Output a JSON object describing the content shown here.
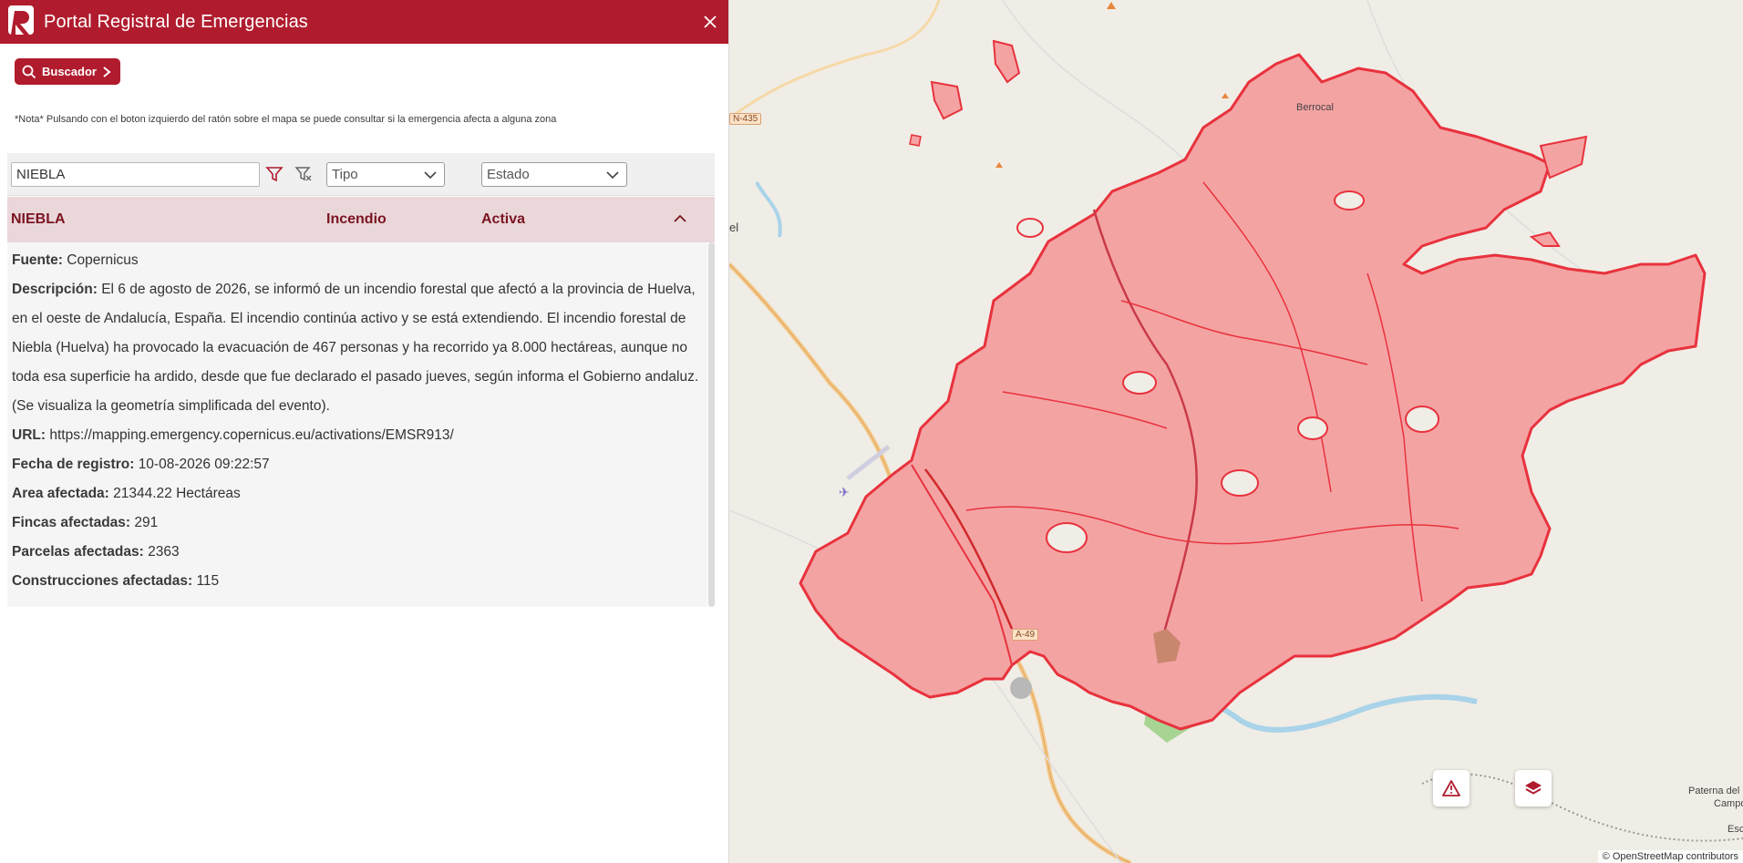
{
  "app": {
    "title": "Portal Registral de Emergencias",
    "logo_letter": "R"
  },
  "toolbar": {
    "buscador_label": "Buscador"
  },
  "note": "*Nota* Pulsando con el boton izquierdo del ratón sobre el mapa se puede consultar si la emergencia afecta a alguna zona",
  "filters": {
    "search_value": "NIEBLA",
    "tipo_label": "Tipo",
    "estado_label": "Estado"
  },
  "result": {
    "name": "NIEBLA",
    "tipo": "Incendio",
    "estado": "Activa"
  },
  "details": {
    "fuente_label": "Fuente:",
    "fuente_value": "Copernicus",
    "descripcion_label": "Descripción:",
    "descripcion_value": "El 6 de agosto de 2026, se informó de un incendio forestal que afectó a la provincia de Huelva, en el oeste de Andalucía, España. El incendio continúa activo y se está extendiendo. El incendio forestal de Niebla (Huelva) ha provocado la evacuación de 467 personas y ha recorrido ya 8.000 hectáreas, aunque no toda esa superficie ha ardido, desde que fue declarado el pasado jueves, según informa el Gobierno andaluz. (Se visualiza la geometría simplificada del evento).",
    "url_label": "URL:",
    "url_value": "https://mapping.emergency.copernicus.eu/activations/EMSR913/",
    "fecha_label": "Fecha de registro:",
    "fecha_value": "10-08-2026 09:22:57",
    "area_label": "Area afectada:",
    "area_value": "21344.22 Hectáreas",
    "fincas_label": "Fincas afectadas:",
    "fincas_value": "291",
    "parcelas_label": "Parcelas afectadas:",
    "parcelas_value": "2363",
    "construcciones_label": "Construcciones afectadas:",
    "construcciones_value": "115"
  },
  "map": {
    "labels": {
      "berrocal": "Berrocal",
      "el": "el",
      "paterna": "Paterna del",
      "campo": "Campo",
      "esca": "Esca"
    },
    "roads": {
      "n435": "N-435",
      "a49": "A-49"
    },
    "attribution": "© OpenStreetMap contributors",
    "colors": {
      "fire_fill": "#f4a3a3",
      "fire_stroke": "#e8323d",
      "brand": "#b01c2e"
    }
  }
}
